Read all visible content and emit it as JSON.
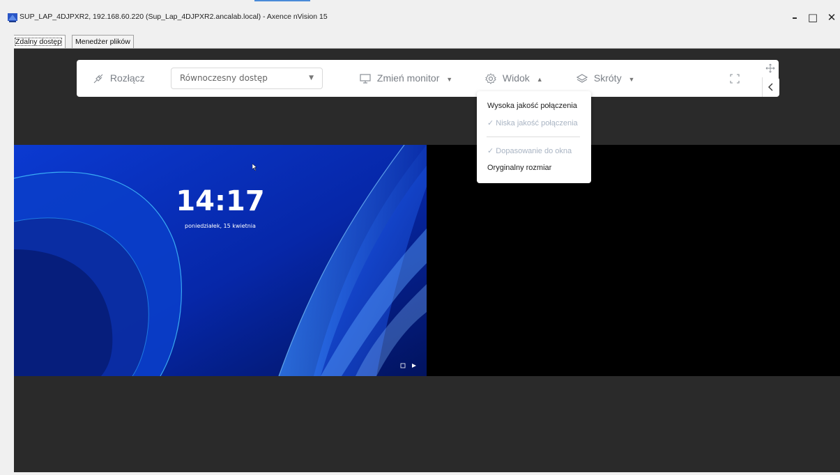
{
  "window": {
    "title": "SUP_LAP_4DJPXR2, 192.168.60.220 (Sup_Lap_4DJPXR2.ancalab.local) - Axence nVision 15",
    "minimize_glyph": "–",
    "maximize_glyph": "□",
    "close_glyph": "✕",
    "app_icon": "axence-app-icon"
  },
  "tabs": [
    {
      "label": "Zdalny dostęp",
      "active": true
    },
    {
      "label": "Menedżer plików",
      "active": false
    }
  ],
  "toolbar": {
    "disconnect_label": "Rozłącz",
    "access_mode_value": "Równoczesny dostęp",
    "monitor_label": "Zmień monitor",
    "view_label": "Widok",
    "shortcuts_label": "Skróty",
    "icons": {
      "disconnect": "plug-icon",
      "monitor": "monitor-icon",
      "view": "gear-icon",
      "shortcuts": "layers-icon",
      "fullscreen": "fullscreen-icon",
      "move": "move-icon",
      "collapse": "chevron-left-icon"
    }
  },
  "view_menu": {
    "items": [
      {
        "label": "Wysoka jakość połączenia",
        "checked": false,
        "enabled": true
      },
      {
        "label": "✓ Niska jakość połączenia",
        "checked": true,
        "enabled": false
      },
      {
        "label": "✓ Dopasowanie do okna",
        "checked": true,
        "enabled": false
      },
      {
        "label": "Oryginalny rozmiar",
        "checked": false,
        "enabled": true
      }
    ]
  },
  "remote_screen": {
    "time": "14:17",
    "date": "poniedziałek, 15 kwietnia"
  },
  "colors": {
    "accent_blue": "#4a8ad8",
    "remote_bg": "#2a2a2a",
    "lockscreen_blue": "#0a2a9a"
  }
}
